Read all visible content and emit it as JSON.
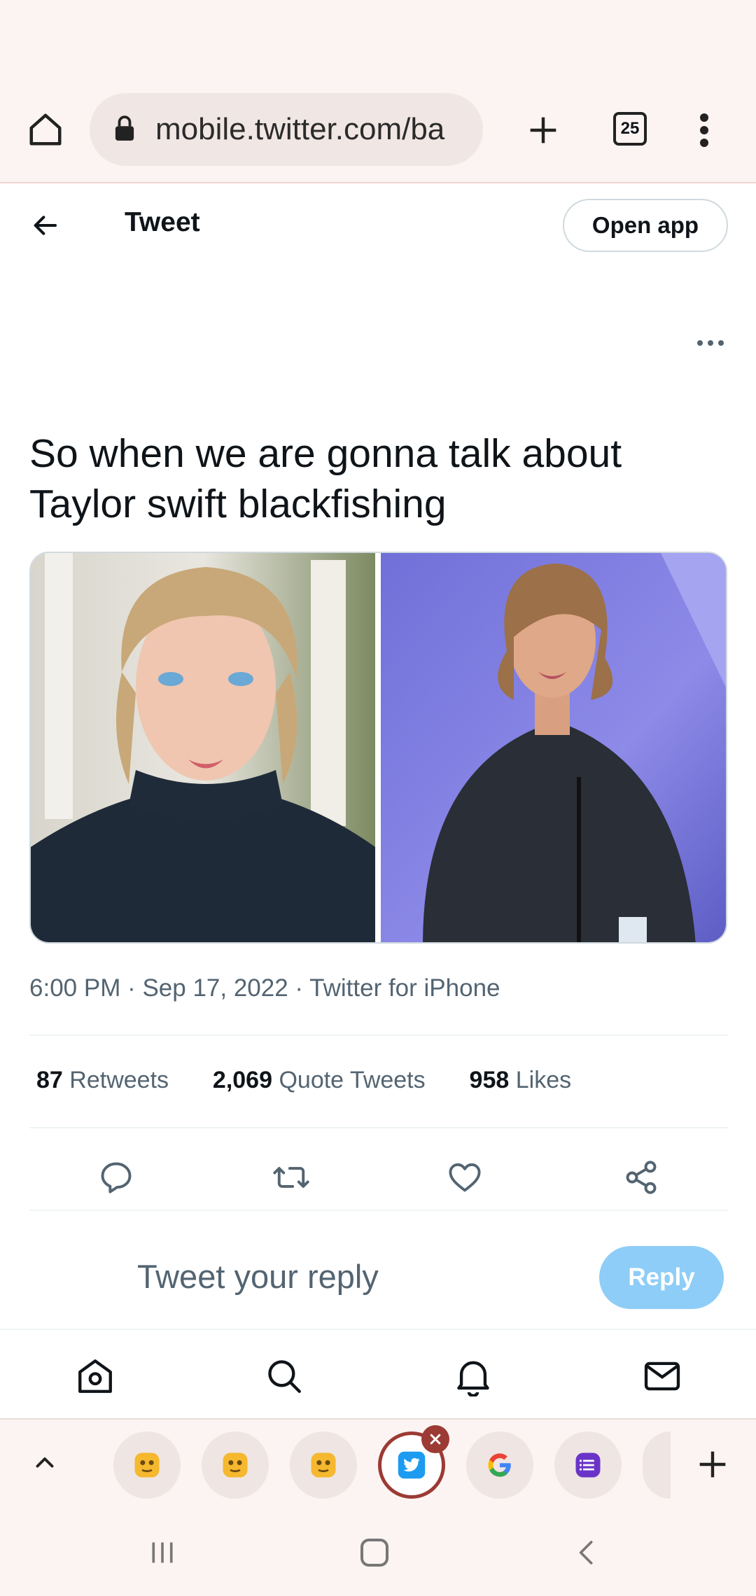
{
  "browser": {
    "url": "mobile.twitter.com/ba",
    "tab_count": "25"
  },
  "header": {
    "title": "Tweet",
    "open_app_label": "Open app"
  },
  "tweet": {
    "text": "So when we are gonna talk about Taylor swift blackfishing",
    "meta": "6:00 PM · Sep 17, 2022 · Twitter for iPhone",
    "stats": {
      "retweets_count": "87",
      "retweets_label": "Retweets",
      "quotes_count": "2,069",
      "quotes_label": "Quote Tweets",
      "likes_count": "958",
      "likes_label": "Likes"
    }
  },
  "reply": {
    "placeholder": "Tweet your reply",
    "button_label": "Reply"
  },
  "colors": {
    "accent": "#1d9bf0",
    "reply_button_disabled": "#8ecdf7",
    "muted_text": "#536471"
  }
}
